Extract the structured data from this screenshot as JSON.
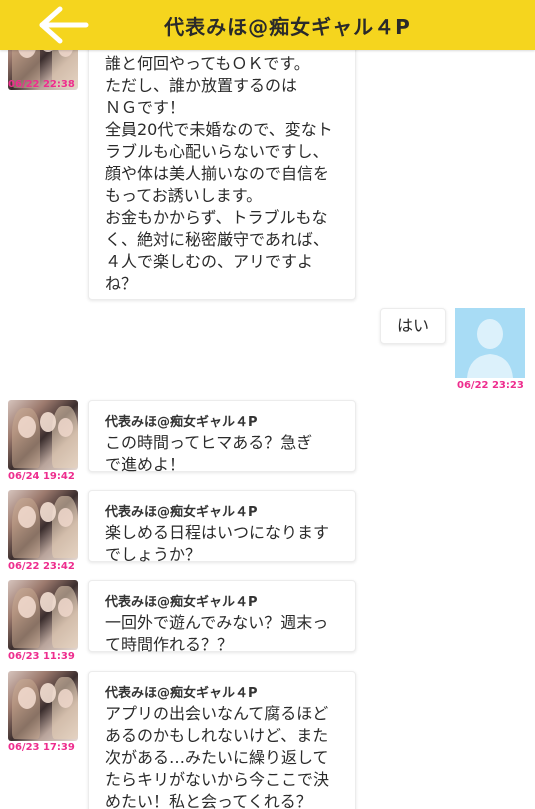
{
  "header": {
    "title": "代表みほ@痴女ギャル４P",
    "back_icon": "back-arrow-icon",
    "color": "#f5d51e"
  },
  "messages": [
    {
      "side": "left",
      "sender": "",
      "text": "誰と何回やってもＯＫです。\nただし、誰か放置するのは\nＮＧです！\n全員20代で未婚なので、変なト\nラブルも心配いらないですし、\n顔や体は美人揃いなので自信を\nもってお誘いします。\nお金もかからず、トラブルもな\nく、絶対に秘密厳守であれば、\n４人で楽しむの、アリですよ\nね？",
      "time": "06/22 22:38"
    },
    {
      "side": "right",
      "text": "はい",
      "time": "06/22 23:23"
    },
    {
      "side": "left",
      "sender": "代表みほ@痴女ギャル４P",
      "text": "この時間ってヒマある？急ぎ\nで進めよ！",
      "time": "06/24 19:42"
    },
    {
      "side": "left",
      "sender": "代表みほ@痴女ギャル４P",
      "text": "楽しめる日程はいつになります\nでしょうか？",
      "time": "06/22 23:42"
    },
    {
      "side": "left",
      "sender": "代表みほ@痴女ギャル４P",
      "text": "一回外で遊んでみない？週末っ\nて時間作れる？？",
      "time": "06/23 11:39"
    },
    {
      "side": "left",
      "sender": "代表みほ@痴女ギャル４P",
      "text": "アプリの出会いなんて腐るほど\nあるのかもしれないけど、また\n次がある…みたいに繰り返して\nたらキリがないから今ここで決\nめたい！私と会ってくれる？",
      "time": "06/23 17:39"
    }
  ],
  "accent_colors": {
    "timestamp": "#ee2d8e",
    "user_avatar_bg": "#a8dcf5"
  }
}
